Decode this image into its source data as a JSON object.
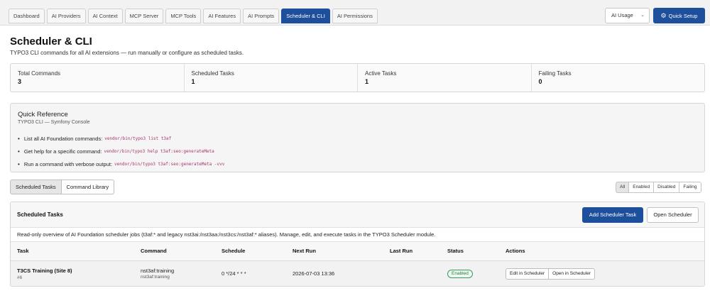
{
  "nav": {
    "tabs": [
      {
        "label": "Dashboard"
      },
      {
        "label": "AI Providers"
      },
      {
        "label": "AI Context"
      },
      {
        "label": "MCP Server"
      },
      {
        "label": "MCP Tools"
      },
      {
        "label": "AI Features"
      },
      {
        "label": "AI Prompts"
      },
      {
        "label": "Scheduler & CLI"
      },
      {
        "label": "AI Permissions"
      }
    ],
    "active_tab": "Scheduler & CLI",
    "usage_select": "AI Usage",
    "quick_setup": "Quick Setup"
  },
  "header": {
    "title": "Scheduler & CLI",
    "subtitle": "TYPO3 CLI commands for all AI extensions — run manually or configure as scheduled tasks."
  },
  "stats": [
    {
      "label": "Total Commands",
      "value": "3"
    },
    {
      "label": "Scheduled Tasks",
      "value": "1"
    },
    {
      "label": "Active Tasks",
      "value": "1"
    },
    {
      "label": "Failing Tasks",
      "value": "0"
    }
  ],
  "quick_reference": {
    "title": "Quick Reference",
    "subtitle": "TYPO3 CLI — Symfony Console",
    "items": [
      {
        "text": "List all AI Foundation commands:",
        "code": "vendor/bin/typo3 list t3af"
      },
      {
        "text": "Get help for a specific command:",
        "code": "vendor/bin/typo3 help t3af:seo:generateMeta"
      },
      {
        "text": "Run a command with verbose output:",
        "code": "vendor/bin/typo3 t3af:seo:generateMeta -vvv"
      }
    ]
  },
  "view_switch": {
    "scheduled": "Scheduled Tasks",
    "library": "Command Library"
  },
  "filters": [
    "All",
    "Enabled",
    "Disabled",
    "Failing"
  ],
  "panel": {
    "title": "Scheduled Tasks",
    "add_button": "Add Scheduler Task",
    "open_button": "Open Scheduler",
    "description": "Read-only overview of AI Foundation scheduler jobs (t3af:* and legacy nst3ai:/nst3aa:/nst3cs:/nst3af:* aliases). Manage, edit, and execute tasks in the TYPO3 Scheduler module.",
    "columns": [
      "Task",
      "Command",
      "Schedule",
      "Next Run",
      "Last Run",
      "Status",
      "Actions"
    ],
    "rows": [
      {
        "task": "T3CS Training (Site 8)",
        "task_id": "#6",
        "command": "nst3af:training",
        "command_sub": "nst3af:training",
        "schedule": "0 */24 * * *",
        "next_run": "2026-07-03 13:36",
        "last_run": "",
        "status": "Enabled",
        "actions": [
          "Edit in Scheduler",
          "Open in Scheduler"
        ]
      }
    ]
  },
  "colors": {
    "primary": "#1e4f9c",
    "success": "#2b7a45",
    "code": "#a8326a"
  }
}
